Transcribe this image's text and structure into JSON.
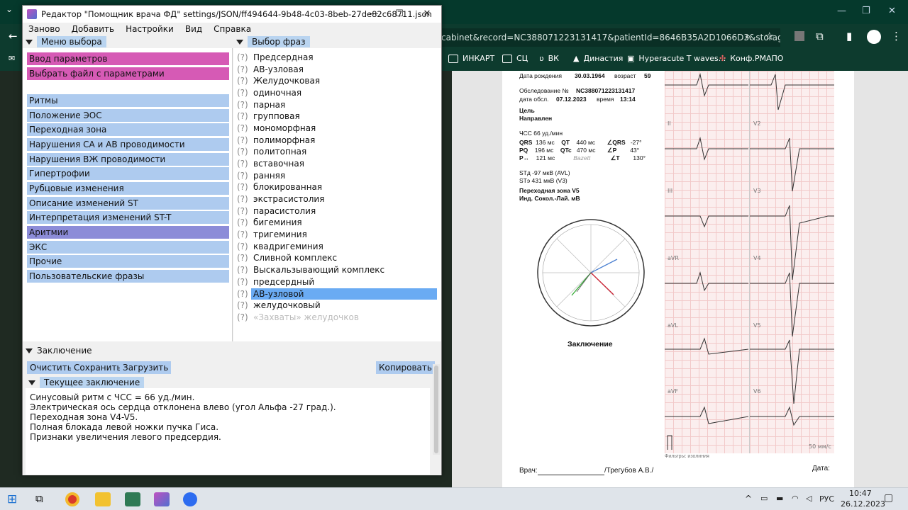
{
  "browser": {
    "url": "cabinet&record=NC388071223131417&patientId=8646B35A2D1066D3&storag...",
    "bookmarks": [
      "ИНКАРТ",
      "СЦ",
      "ВК",
      "Династия",
      "Hyperacute T waves...",
      "Конф.РМАПО"
    ]
  },
  "app": {
    "title": "Редактор \"Помощник врача ФД\" settings/JSON/ff494644-9b48-4c03-8beb-27de82c68711.json",
    "menu": [
      "Заново",
      "Добавить",
      "Настройки",
      "Вид",
      "Справка"
    ],
    "left_header": "Меню выбора",
    "right_header": "Выбор фраз",
    "left_top_items": [
      "Ввод параметров",
      "Выбрать файл с параметрами"
    ],
    "left_items": [
      "Ритмы",
      "Положение ЭОС",
      "Переходная зона",
      "Нарушения СА и АВ проводимости",
      "Нарушения ВЖ проводимости",
      "Гипертрофии",
      "Рубцовые изменения",
      "Описание изменений ST",
      "Интерпретация изменений ST-T",
      "Аритмии",
      "ЭКС",
      "Прочие",
      "Пользовательские фразы"
    ],
    "phrase_marker": "(?)",
    "phrases": [
      "Предсердная",
      "АВ-узловая",
      "Желудочковая",
      "одиночная",
      "парная",
      "групповая",
      "мономорфная",
      "полиморфная",
      "политопная",
      "вставочная",
      "ранняя",
      "блокированная",
      "экстрасистолия",
      "парасистолия",
      "бигеминия",
      "тригеминия",
      "квадригеминия",
      "Сливной комплекс",
      "Выскальзывающий комплекс",
      "предсердный",
      "АВ-узловой",
      "желудочковый",
      "«Захваты» желудочков"
    ],
    "conclusion_header": "Заключение",
    "buttons": {
      "clear": "Очистить",
      "save": "Сохранить",
      "load": "Загрузить",
      "copy": "Копировать"
    },
    "current_header": "Текущее заключение",
    "conclusion_lines": [
      "Синусовый ритм с ЧСС = 66 уд./мин.",
      "Электрическая ось сердца отклонена влево (угол Альфа -27 град.).",
      "Переходная зона V4-V5.",
      "Полная блокада левой ножки пучка Гиса.",
      "Признаки увеличения левого предсердия."
    ]
  },
  "report": {
    "dob_label": "Дата рождения",
    "dob": "30.03.1964",
    "age_label": "возраст",
    "age": "59",
    "exam_label": "Обследование №",
    "exam_no": "NC388071223131417",
    "date_label": "дата обсл.",
    "date": "07.12.2023",
    "time_label": "время",
    "time": "13:14",
    "goal": "Цель",
    "referred": "Направлен",
    "hr": "ЧСС    66 уд./мин",
    "params": [
      [
        "QRS",
        "136 мс",
        "QT",
        "440 мс",
        "∠QRS",
        "-27°"
      ],
      [
        "PQ",
        "196 мс",
        "QTc",
        "470 мс",
        "∠P",
        "43°"
      ],
      [
        "P↔",
        "121 мс",
        "",
        "Bazett",
        "∠T",
        "130°"
      ]
    ],
    "std": "STд   -97 мкВ (AVL)",
    "ste": "STэ   431 мкВ (V3)",
    "tz": "Переходная зона       V5",
    "sokol": "Инд. Сокол.-Лай.       мВ",
    "conclusion_title": "Заключение",
    "leads": [
      "II",
      "V2",
      "III",
      "V3",
      "aVR",
      "V4",
      "aVL",
      "V5",
      "aVF",
      "V6"
    ],
    "speed": "50 мм/с",
    "filters": "Фильтры: изолиния",
    "doctor_label": "Врач:",
    "doctor_name": "/Трегубов А.В./",
    "date_sign": "Дата:"
  },
  "taskbar": {
    "lang": "РУС",
    "time": "10:47",
    "date": "26.12.2023"
  }
}
